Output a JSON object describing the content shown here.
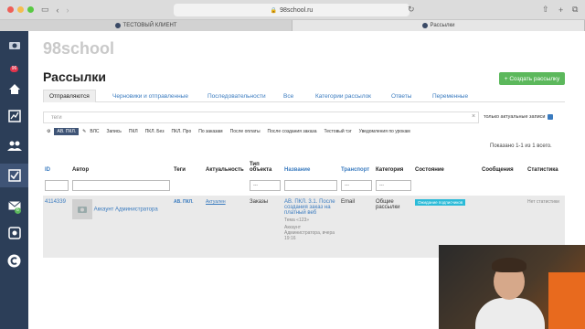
{
  "browser": {
    "url": "98school.ru",
    "tabs": [
      {
        "label": "ТЕСТОВЫЙ КЛИЕНТ"
      },
      {
        "label": "Рассылки"
      }
    ]
  },
  "sidebar": {
    "items": [
      {
        "icon": "camera-icon"
      },
      {
        "icon": "counter-badge",
        "badge": "96"
      },
      {
        "icon": "home-icon"
      },
      {
        "icon": "chart-icon"
      },
      {
        "icon": "users-icon"
      },
      {
        "icon": "checkbox-icon"
      },
      {
        "icon": "mail-icon",
        "badge": "6"
      },
      {
        "icon": "settings-icon"
      },
      {
        "icon": "logo-c-icon"
      }
    ]
  },
  "page": {
    "logo": "98school",
    "title": "Рассылки",
    "create_button": "+ Создать рассылку"
  },
  "tabs": [
    {
      "label": "Отправляются"
    },
    {
      "label": "Черновики и отправленные"
    },
    {
      "label": "Последовательности"
    },
    {
      "label": "Все"
    },
    {
      "label": "Категории рассылок"
    },
    {
      "label": "Ответы"
    },
    {
      "label": "Переменные"
    }
  ],
  "filters": {
    "search_placeholder": "теги",
    "only_actual": "только актуальные записи",
    "tags": [
      "АВ. ПКЛ.",
      "ВЛС",
      "Запись",
      "ПКЛ",
      "ПКЛ. Без",
      "ПКЛ. Про",
      "По заказам",
      "После оплаты",
      "После создания заказа",
      "Тестовый тэг",
      "Уведомления по урокам"
    ]
  },
  "shown": "Показано 1-1 из 1 всего.",
  "table": {
    "headers": [
      "ID",
      "Автор",
      "Теги",
      "Актуальность",
      "Тип объекта",
      "Название",
      "Транспорт",
      "Категория",
      "Состояние",
      "Сообщения",
      "Статистика"
    ],
    "select_placeholder": "---",
    "row": {
      "id": "4114339",
      "author": "Аккаунт Администратора",
      "tag": "АВ. ПКЛ.",
      "actuality": "Актуален",
      "object_type": "Заказы",
      "title": "АВ. ПКЛ. 3.1. После создания заказ на платный веб",
      "subject": "Тема «123»",
      "meta": "Аккаунт Администратора, вчера 19:16",
      "transport": "Email",
      "category": "Общие рассылки",
      "status": "Ожидание подписчиков",
      "messages": "",
      "stats": "Нет статистики"
    }
  }
}
